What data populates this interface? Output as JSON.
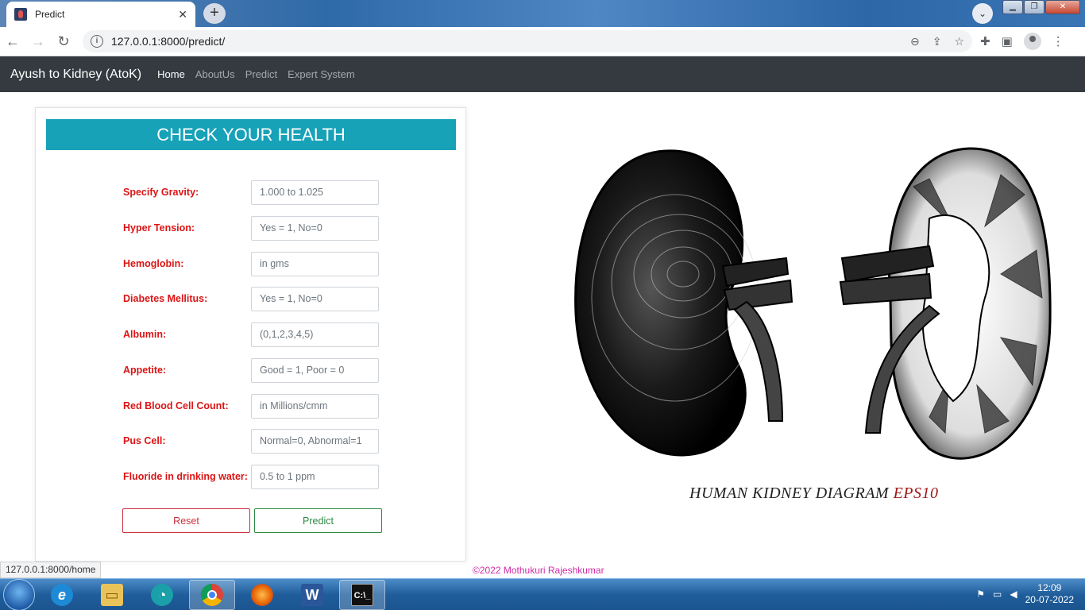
{
  "browser": {
    "tab_title": "Predict",
    "tab_close": "✕",
    "new_tab": "+",
    "url": "127.0.0.1:8000/predict/",
    "status_url": "127.0.0.1:8000/home"
  },
  "navbar": {
    "brand": "Ayush to Kidney (AtoK)",
    "links": [
      "Home",
      "AboutUs",
      "Predict",
      "Expert System"
    ],
    "active": "Home"
  },
  "form": {
    "heading": "CHECK YOUR HEALTH",
    "fields": [
      {
        "label": "Specify Gravity:",
        "placeholder": "1.000 to 1.025"
      },
      {
        "label": "Hyper Tension:",
        "placeholder": "Yes = 1, No=0"
      },
      {
        "label": "Hemoglobin:",
        "placeholder": "in gms"
      },
      {
        "label": "Diabetes Mellitus:",
        "placeholder": "Yes = 1, No=0"
      },
      {
        "label": "Albumin:",
        "placeholder": "(0,1,2,3,4,5)"
      },
      {
        "label": "Appetite:",
        "placeholder": "Good = 1, Poor = 0"
      },
      {
        "label": "Red Blood Cell Count:",
        "placeholder": "in Millions/cmm"
      },
      {
        "label": "Pus Cell:",
        "placeholder": "Normal=0, Abnormal=1"
      },
      {
        "label": "Fluoride in drinking water:",
        "placeholder": "0.5 to 1 ppm"
      }
    ],
    "reset_label": "Reset",
    "predict_label": "Predict"
  },
  "illustration": {
    "caption_main": "HUMAN KIDNEY DIAGRAM",
    "caption_suffix": "EPS10"
  },
  "footer": "©2022 Mothukuri Rajeshkumar",
  "taskbar": {
    "time": "12:09",
    "date": "20-07-2022"
  },
  "colors": {
    "navbar_bg": "#343a40",
    "header_bg": "#17a2b8",
    "label_red": "#dc1414",
    "reset_red": "#c9303f",
    "predict_green": "#2a8a43",
    "footer_magenta": "#d02aa6"
  }
}
